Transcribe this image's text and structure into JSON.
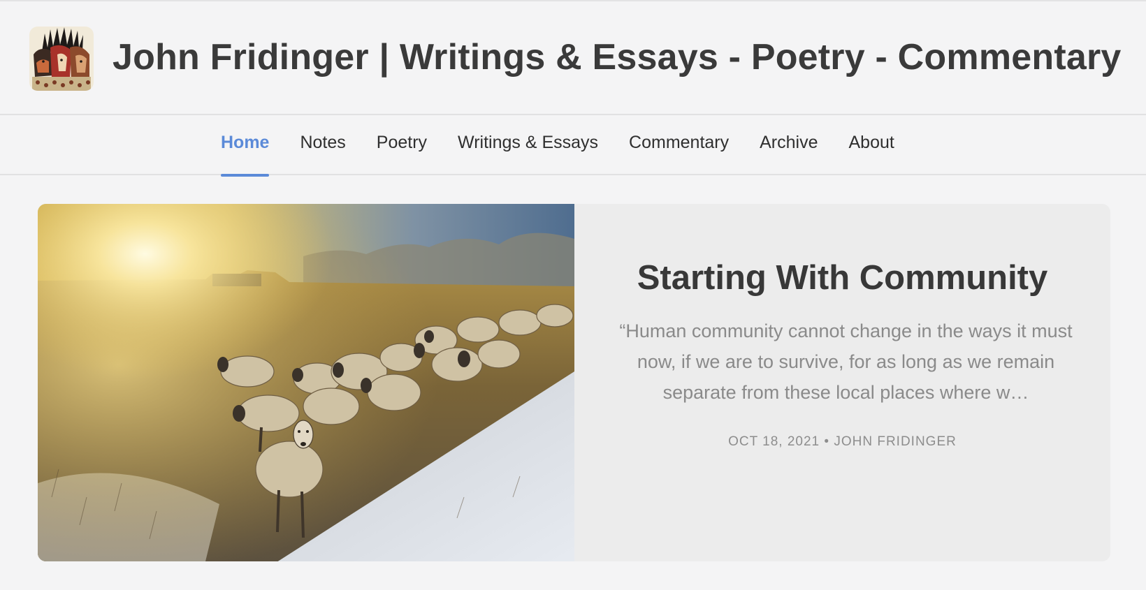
{
  "site": {
    "title": "John Fridinger | Writings & Essays - Poetry - Commentary"
  },
  "nav": {
    "items": [
      {
        "label": "Home",
        "active": true
      },
      {
        "label": "Notes"
      },
      {
        "label": "Poetry"
      },
      {
        "label": "Writings & Essays"
      },
      {
        "label": "Commentary"
      },
      {
        "label": "Archive"
      },
      {
        "label": "About"
      }
    ],
    "accent_color": "#5b8ad8"
  },
  "featured_post": {
    "title": "Starting With Community",
    "excerpt": "“Human community cannot change in the ways it must now, if we are to survive, for as long as we remain separate from these local places where w…",
    "date": "OCT 18, 2021",
    "separator": "•",
    "author": "JOHN FRIDINGER",
    "image": "sheep-in-snowy-field-at-sunrise"
  }
}
